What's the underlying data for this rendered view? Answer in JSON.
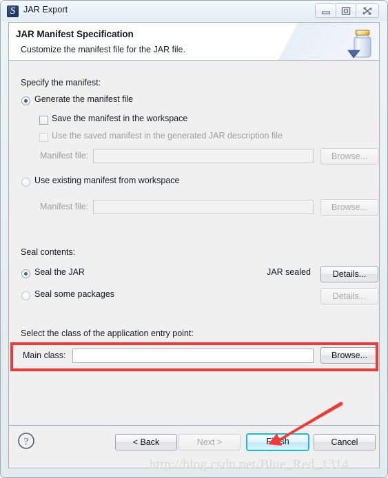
{
  "window": {
    "title": "JAR Export",
    "icon": "jar-export-icon",
    "controls": {
      "minimize": "minimize-icon",
      "maximize": "maximize-icon",
      "close": "close-icon"
    }
  },
  "header": {
    "title": "JAR Manifest Specification",
    "subtitle": "Customize the manifest file for the JAR file.",
    "banner_icon": "jar-with-arrow-icon"
  },
  "manifest_section": {
    "heading": "Specify the manifest:",
    "generate_radio": {
      "label": "Generate the manifest file",
      "selected": true
    },
    "save_checkbox": {
      "label": "Save the manifest in the workspace",
      "checked": false,
      "enabled": true
    },
    "use_saved_checkbox": {
      "label": "Use the saved manifest in the generated JAR description file",
      "checked": false,
      "enabled": false
    },
    "generate_file": {
      "label": "Manifest file:",
      "value": "",
      "placeholder": "",
      "browse_label": "Browse...",
      "enabled": false
    },
    "existing_radio": {
      "label": "Use existing manifest from workspace",
      "selected": false
    },
    "existing_file": {
      "label": "Manifest file:",
      "value": "",
      "placeholder": "",
      "browse_label": "Browse...",
      "enabled": false
    }
  },
  "seal_section": {
    "heading": "Seal contents:",
    "seal_jar_radio": {
      "label": "Seal the JAR",
      "selected": true
    },
    "seal_status": "JAR sealed",
    "seal_jar_details": {
      "label": "Details...",
      "enabled": true
    },
    "seal_packages_radio": {
      "label": "Seal some packages",
      "selected": false
    },
    "seal_packages_details": {
      "label": "Details...",
      "enabled": false
    }
  },
  "entry_point_section": {
    "heading": "Select the class of the application entry point:",
    "main_class": {
      "label": "Main class:",
      "value": "",
      "placeholder": "",
      "browse_label": "Browse..."
    },
    "highlight_color": "#f23a33"
  },
  "button_bar": {
    "help_icon": "help-question-icon",
    "back": {
      "label": "< Back",
      "enabled": true
    },
    "next": {
      "label": "Next >",
      "enabled": false
    },
    "finish": {
      "label": "Finish",
      "enabled": true,
      "focused": true
    },
    "cancel": {
      "label": "Cancel",
      "enabled": true
    }
  },
  "annotations": {
    "arrow_color": "#f23a33",
    "watermark": "http://blog.csdn.net/Blue_Red_1314"
  }
}
